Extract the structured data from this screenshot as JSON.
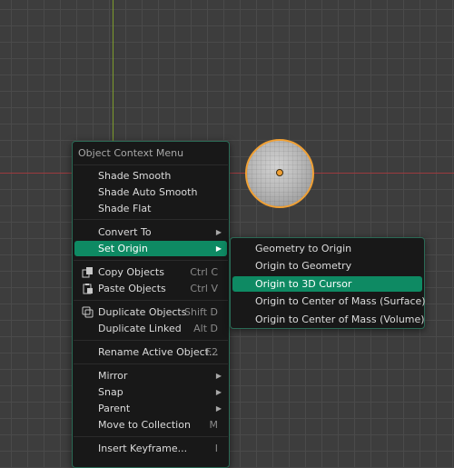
{
  "colors": {
    "viewport_background": "#3d3d3d",
    "grid_line": "#4a4a4a",
    "x_axis": "#9b3a3e",
    "y_axis": "#7d9b2c",
    "menu_background": "#181818",
    "menu_border": "#2a6a55",
    "highlight": "#0e8a63",
    "selection_outline": "#f0a034"
  },
  "context_menu": {
    "title": "Object Context Menu",
    "items": [
      {
        "label": "Shade Smooth"
      },
      {
        "label": "Shade Auto Smooth"
      },
      {
        "label": "Shade Flat"
      },
      {
        "label": "Convert To",
        "submenu_arrow": "▶"
      },
      {
        "label": "Set Origin",
        "submenu_arrow": "▶",
        "active": true
      },
      {
        "label": "Copy Objects",
        "shortcut": "Ctrl C",
        "icon": "copy-icon"
      },
      {
        "label": "Paste Objects",
        "shortcut": "Ctrl V",
        "icon": "paste-icon"
      },
      {
        "label": "Duplicate Objects",
        "shortcut": "Shift D",
        "icon": "duplicate-icon"
      },
      {
        "label": "Duplicate Linked",
        "shortcut": "Alt D"
      },
      {
        "label": "Rename Active Object...",
        "shortcut": "F2"
      },
      {
        "label": "Mirror",
        "submenu_arrow": "▶"
      },
      {
        "label": "Snap",
        "submenu_arrow": "▶"
      },
      {
        "label": "Parent",
        "submenu_arrow": "▶"
      },
      {
        "label": "Move to Collection",
        "shortcut": "M"
      },
      {
        "label": "Insert Keyframe...",
        "shortcut": "I"
      }
    ]
  },
  "set_origin_submenu": {
    "items": [
      {
        "label": "Geometry to Origin"
      },
      {
        "label": "Origin to Geometry"
      },
      {
        "label": "Origin to 3D Cursor",
        "active": true
      },
      {
        "label": "Origin to Center of Mass (Surface)"
      },
      {
        "label": "Origin to Center of Mass (Volume)"
      }
    ]
  }
}
